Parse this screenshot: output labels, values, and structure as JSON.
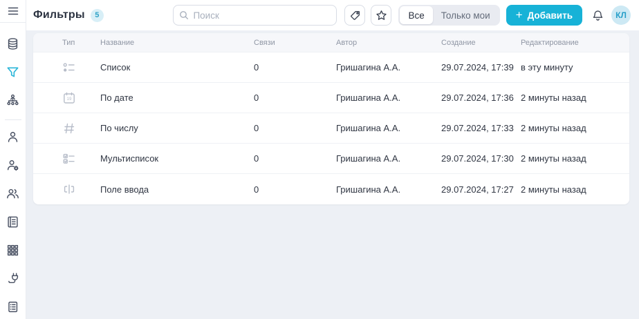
{
  "colors": {
    "accent": "#17b2d7",
    "accent_icon": "#29b5d8",
    "page_background": "#edf0f5",
    "badge_background": "#d8eff7",
    "badge_text": "#2fa3c7",
    "avatar_background": "#cde9f4",
    "avatar_text": "#279fc9"
  },
  "header": {
    "title": "Фильтры",
    "count_badge": "5",
    "search": {
      "placeholder": "Поиск"
    },
    "filter_toggle": {
      "options": [
        "Все",
        "Только мои"
      ],
      "selected": "Все"
    },
    "add_button": {
      "plus": "+",
      "label": "Добавить"
    },
    "avatar_initials": "КЛ"
  },
  "sidebar": {
    "active_item": "filters",
    "icons": [
      "menu",
      "database",
      "filter",
      "org-structure",
      "user",
      "user-settings",
      "users-group",
      "handbook",
      "apps-grid",
      "plug-integrations",
      "log-journal"
    ]
  },
  "table": {
    "columns": [
      "Тип",
      "Название",
      "Связи",
      "Автор",
      "Создание",
      "Редактирование"
    ],
    "rows": [
      {
        "type_icon": "list-icon",
        "name": "Список",
        "links": "0",
        "author": "Гришагина А.А.",
        "created": "29.07.2024, 17:39",
        "edited": "в эту минуту"
      },
      {
        "type_icon": "calendar-icon",
        "name": "По дате",
        "links": "0",
        "author": "Гришагина А.А.",
        "created": "29.07.2024, 17:36",
        "edited": "2 минуты назад"
      },
      {
        "type_icon": "number-icon",
        "name": "По числу",
        "links": "0",
        "author": "Гришагина А.А.",
        "created": "29.07.2024, 17:33",
        "edited": "2 минуты назад"
      },
      {
        "type_icon": "multilist-icon",
        "name": "Мультисписок",
        "links": "0",
        "author": "Гришагина А.А.",
        "created": "29.07.2024, 17:30",
        "edited": "2 минуты назад"
      },
      {
        "type_icon": "input-icon",
        "name": "Поле ввода",
        "links": "0",
        "author": "Гришагина А.А.",
        "created": "29.07.2024, 17:27",
        "edited": "2 минуты назад"
      }
    ]
  }
}
